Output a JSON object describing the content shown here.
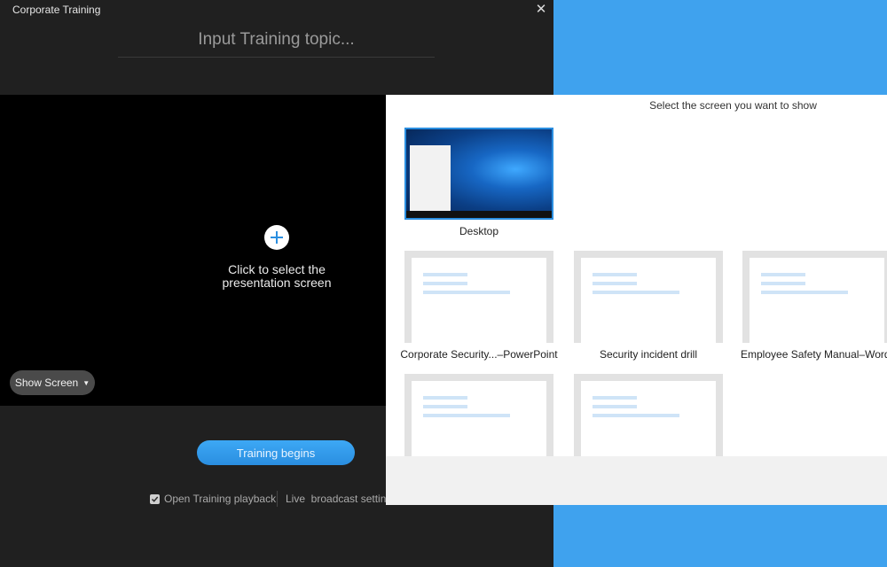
{
  "window": {
    "title": "Corporate Training",
    "close_symbol": "✕"
  },
  "topic": {
    "placeholder": "Input Training topic..."
  },
  "stage": {
    "hint_line1": "Click to select the",
    "hint_line2": "presentation screen",
    "show_screen_label": "Show Screen",
    "caret": "▼"
  },
  "actions": {
    "begin_label": "Training begins",
    "playback_label": "Open Training playback",
    "playback_checked": true,
    "live_label": "Live  broadcast settings"
  },
  "selector": {
    "title": "Select the screen you want to show",
    "desktop_label": "Desktop",
    "items": [
      {
        "label": "Corporate Security...–PowerPoint"
      },
      {
        "label": "Security incident drill"
      },
      {
        "label": "Employee Safety Manual–Word"
      },
      {
        "label": ""
      },
      {
        "label": ""
      }
    ]
  },
  "colors": {
    "accent": "#2a8ee0",
    "background_blue": "#3fa2ee",
    "window_bg": "#202020"
  }
}
